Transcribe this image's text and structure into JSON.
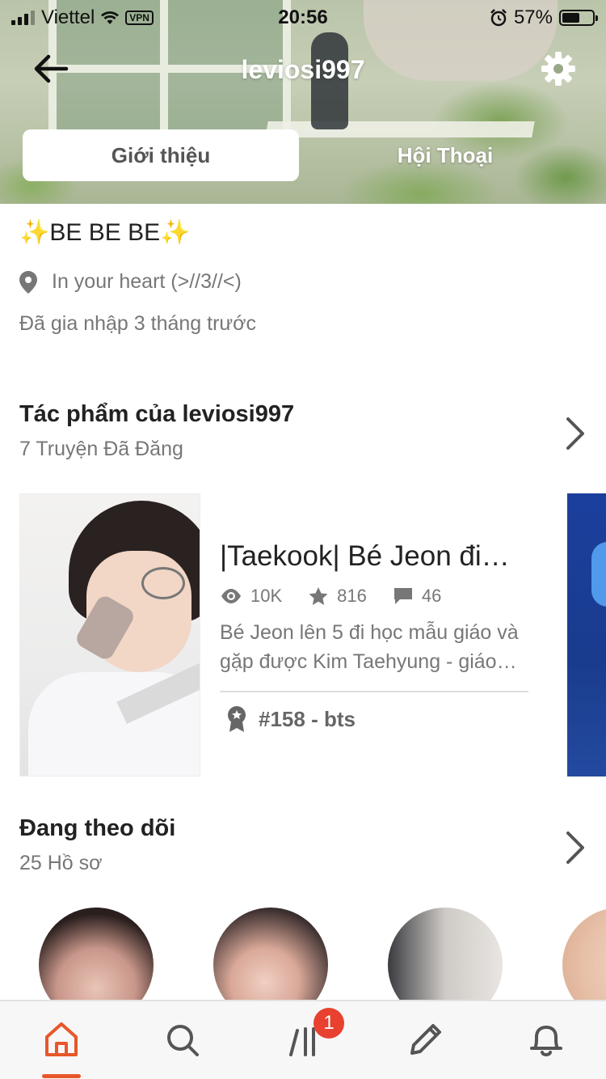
{
  "status_bar": {
    "carrier": "Viettel",
    "vpn": "VPN",
    "time": "20:56",
    "battery_text": "57%",
    "battery_level": 0.57
  },
  "header": {
    "title": "leviosi997",
    "tabs": [
      {
        "label": "Giới thiệu",
        "active": true
      },
      {
        "label": "Hội Thoại",
        "active": false
      }
    ]
  },
  "about": {
    "sparkle_left": "✨",
    "headline": "BE BE BE",
    "sparkle_right": "✨",
    "location": "In your heart (>//3//<)",
    "joined": "Đã gia nhập 3 tháng trước"
  },
  "works": {
    "title": "Tác phẩm của leviosi997",
    "subtitle": "7 Truyện Đã Đăng",
    "stories": [
      {
        "title": "|Taekook| Bé Jeon đi…",
        "views": "10K",
        "votes": "816",
        "comments": "46",
        "description_line1": "Bé Jeon lên 5 đi học mẫu giáo và",
        "description_line2": "gặp được Kim Taehyung - giáo…",
        "rank": "#158 - bts"
      }
    ]
  },
  "following": {
    "title": "Đang theo dõi",
    "subtitle": "25 Hồ sơ"
  },
  "bottom_nav": {
    "badge": "1",
    "active": "home",
    "accent": "#e8572a"
  }
}
